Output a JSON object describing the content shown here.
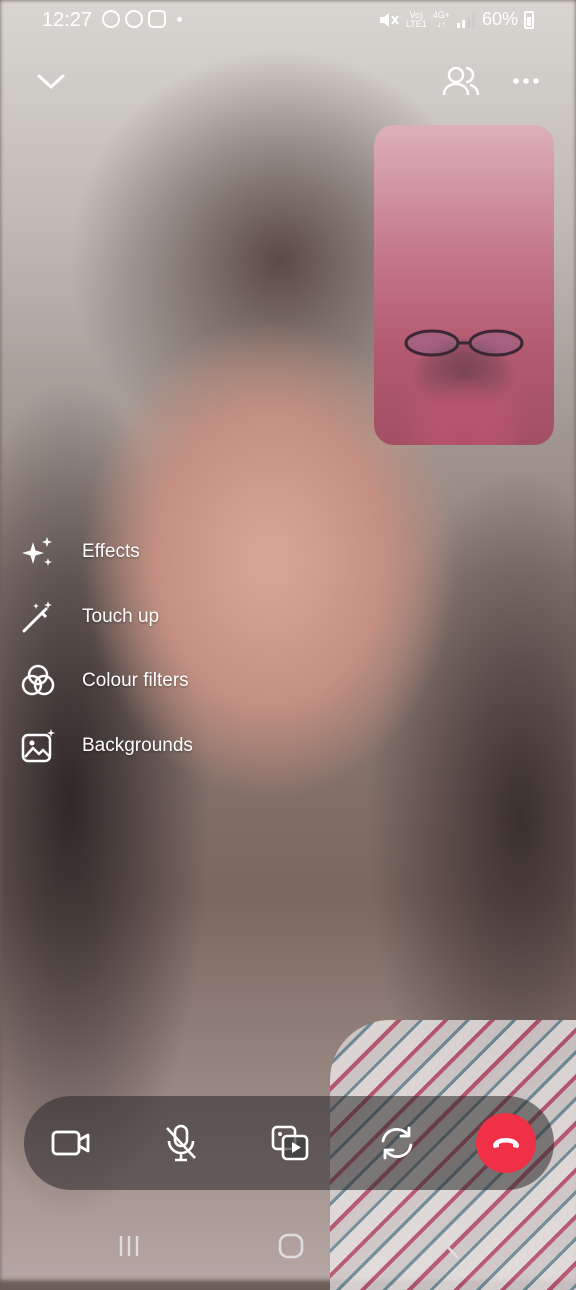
{
  "status_bar": {
    "time": "12:27",
    "network": "4G+",
    "network_sub": "LTE1",
    "battery": "60%"
  },
  "menu": {
    "items": [
      {
        "label": "Effects",
        "icon": "sparkles-icon"
      },
      {
        "label": "Touch up",
        "icon": "magic-wand-icon"
      },
      {
        "label": "Colour filters",
        "icon": "color-circles-icon"
      },
      {
        "label": "Backgrounds",
        "icon": "image-sparkle-icon"
      }
    ]
  },
  "controls": {
    "video": "video-camera-icon",
    "mic": "mic-off-icon",
    "share": "share-media-icon",
    "flip": "flip-camera-icon",
    "end": "end-call-icon",
    "end_color": "#f03047"
  }
}
